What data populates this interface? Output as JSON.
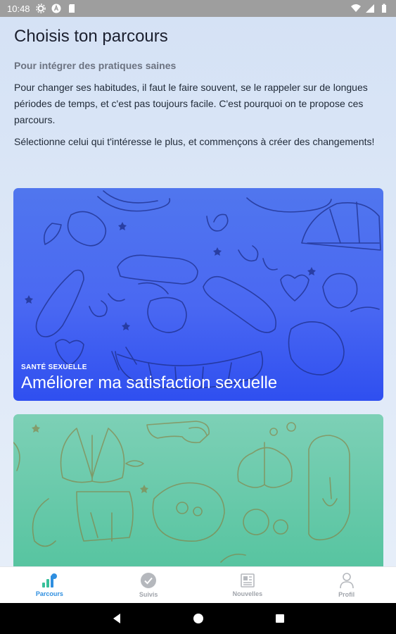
{
  "status": {
    "time": "10:48"
  },
  "main": {
    "title": "Choisis ton parcours",
    "subtitle": "Pour intégrer des pratiques saines",
    "paragraph1": "Pour changer ses habitudes, il faut le faire souvent, se le rappeler sur de longues périodes de temps, et c'est pas toujours facile. C'est pourquoi on te propose ces parcours.",
    "paragraph2": "Sélectionne celui qui t'intéresse le plus, et commençons à créer des changements!"
  },
  "cards": [
    {
      "category": "SANTÉ SEXUELLE",
      "title": "Améliorer ma satisfaction sexuelle",
      "color": "#3d5cf0"
    },
    {
      "category": "",
      "title": "",
      "color": "#5dc6a4"
    }
  ],
  "nav": {
    "items": [
      {
        "label": "Parcours",
        "icon": "chart-icon",
        "active": true
      },
      {
        "label": "Suivis",
        "icon": "check-circle-icon",
        "active": false
      },
      {
        "label": "Nouvelles",
        "icon": "newspaper-icon",
        "active": false
      },
      {
        "label": "Profil",
        "icon": "person-icon",
        "active": false
      }
    ]
  },
  "colors": {
    "accent": "#2f8fe0",
    "background": "#dde8f7"
  }
}
